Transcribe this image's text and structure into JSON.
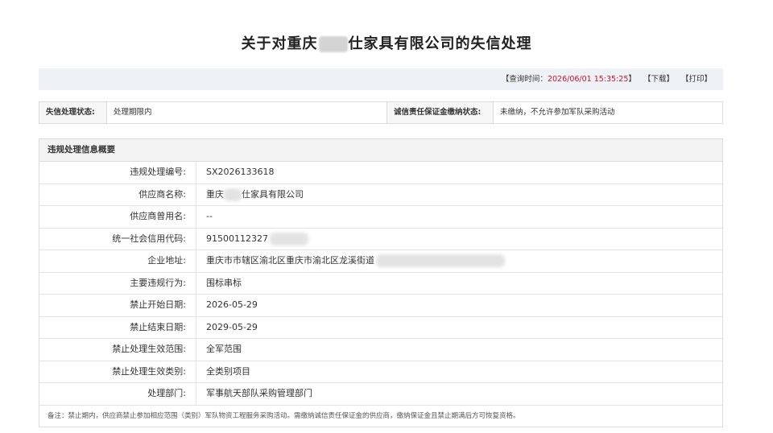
{
  "title": {
    "prefix": "关于对重庆",
    "suffix": "仕家具有限公司的失信处理"
  },
  "query": {
    "label": "【查询时间：",
    "time": "2026/06/01 15:35:25",
    "close": "】",
    "download": "【下载】",
    "print": "【打印】"
  },
  "status": {
    "state_label": "失信处理状态:",
    "state_value": "处理期限内",
    "deposit_label": "诚信责任保证金缴纳状态:",
    "deposit_value": "未缴纳，不允许参加军队采购活动"
  },
  "info": {
    "header": "违规处理信息概要",
    "rows": [
      {
        "label": "违规处理编号:",
        "value": "SX2026133618"
      },
      {
        "label": "供应商名称:",
        "value_prefix": "重庆",
        "value_suffix": "仕家具有限公司"
      },
      {
        "label": "供应商曾用名:",
        "value": "--"
      },
      {
        "label": "统一社会信用代码:",
        "value": "91500112327"
      },
      {
        "label": "企业地址:",
        "value": "重庆市市辖区渝北区重庆市渝北区龙溪街道"
      },
      {
        "label": "主要违规行为:",
        "value": "围标串标"
      },
      {
        "label": "禁止开始日期:",
        "value": "2026-05-29"
      },
      {
        "label": "禁止结束日期:",
        "value": "2029-05-29"
      },
      {
        "label": "禁止处理生效范围:",
        "value": "全军范围"
      },
      {
        "label": "禁止处理生效类别:",
        "value": "全类别项目"
      },
      {
        "label": "处理部门:",
        "value": "军事航天部队采购管理部门"
      }
    ],
    "remark": "备注：禁止期内，供应商禁止参加相应范围（类别）军队物资工程服务采购活动。需缴纳诚信责任保证金的供应商，缴纳保证金且禁止期满后方可恢复资格。"
  }
}
